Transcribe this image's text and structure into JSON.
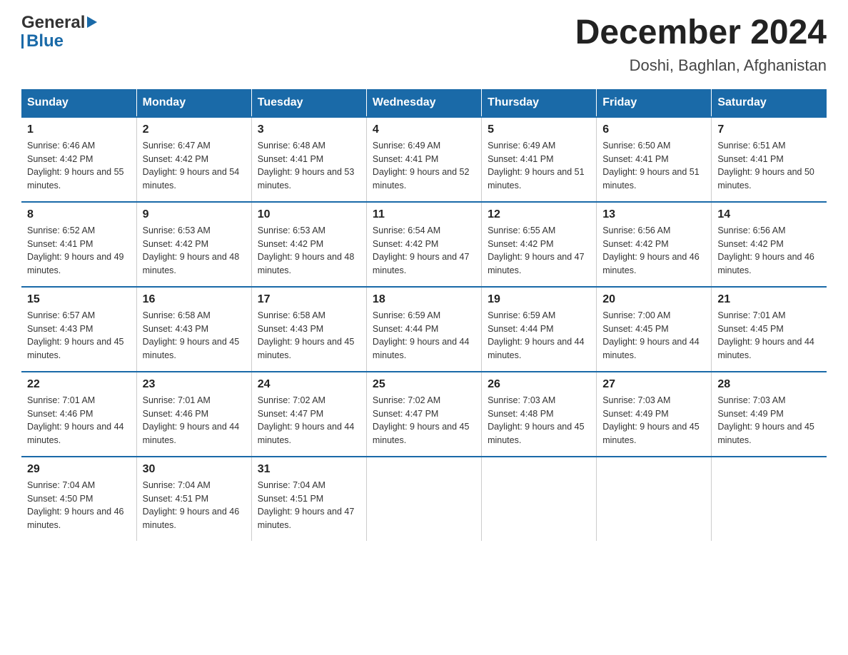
{
  "header": {
    "title": "December 2024",
    "subtitle": "Doshi, Baghlan, Afghanistan"
  },
  "days_header": [
    "Sunday",
    "Monday",
    "Tuesday",
    "Wednesday",
    "Thursday",
    "Friday",
    "Saturday"
  ],
  "weeks": [
    [
      {
        "day": "1",
        "sunrise": "6:46 AM",
        "sunset": "4:42 PM",
        "daylight": "9 hours and 55 minutes."
      },
      {
        "day": "2",
        "sunrise": "6:47 AM",
        "sunset": "4:42 PM",
        "daylight": "9 hours and 54 minutes."
      },
      {
        "day": "3",
        "sunrise": "6:48 AM",
        "sunset": "4:41 PM",
        "daylight": "9 hours and 53 minutes."
      },
      {
        "day": "4",
        "sunrise": "6:49 AM",
        "sunset": "4:41 PM",
        "daylight": "9 hours and 52 minutes."
      },
      {
        "day": "5",
        "sunrise": "6:49 AM",
        "sunset": "4:41 PM",
        "daylight": "9 hours and 51 minutes."
      },
      {
        "day": "6",
        "sunrise": "6:50 AM",
        "sunset": "4:41 PM",
        "daylight": "9 hours and 51 minutes."
      },
      {
        "day": "7",
        "sunrise": "6:51 AM",
        "sunset": "4:41 PM",
        "daylight": "9 hours and 50 minutes."
      }
    ],
    [
      {
        "day": "8",
        "sunrise": "6:52 AM",
        "sunset": "4:41 PM",
        "daylight": "9 hours and 49 minutes."
      },
      {
        "day": "9",
        "sunrise": "6:53 AM",
        "sunset": "4:42 PM",
        "daylight": "9 hours and 48 minutes."
      },
      {
        "day": "10",
        "sunrise": "6:53 AM",
        "sunset": "4:42 PM",
        "daylight": "9 hours and 48 minutes."
      },
      {
        "day": "11",
        "sunrise": "6:54 AM",
        "sunset": "4:42 PM",
        "daylight": "9 hours and 47 minutes."
      },
      {
        "day": "12",
        "sunrise": "6:55 AM",
        "sunset": "4:42 PM",
        "daylight": "9 hours and 47 minutes."
      },
      {
        "day": "13",
        "sunrise": "6:56 AM",
        "sunset": "4:42 PM",
        "daylight": "9 hours and 46 minutes."
      },
      {
        "day": "14",
        "sunrise": "6:56 AM",
        "sunset": "4:42 PM",
        "daylight": "9 hours and 46 minutes."
      }
    ],
    [
      {
        "day": "15",
        "sunrise": "6:57 AM",
        "sunset": "4:43 PM",
        "daylight": "9 hours and 45 minutes."
      },
      {
        "day": "16",
        "sunrise": "6:58 AM",
        "sunset": "4:43 PM",
        "daylight": "9 hours and 45 minutes."
      },
      {
        "day": "17",
        "sunrise": "6:58 AM",
        "sunset": "4:43 PM",
        "daylight": "9 hours and 45 minutes."
      },
      {
        "day": "18",
        "sunrise": "6:59 AM",
        "sunset": "4:44 PM",
        "daylight": "9 hours and 44 minutes."
      },
      {
        "day": "19",
        "sunrise": "6:59 AM",
        "sunset": "4:44 PM",
        "daylight": "9 hours and 44 minutes."
      },
      {
        "day": "20",
        "sunrise": "7:00 AM",
        "sunset": "4:45 PM",
        "daylight": "9 hours and 44 minutes."
      },
      {
        "day": "21",
        "sunrise": "7:01 AM",
        "sunset": "4:45 PM",
        "daylight": "9 hours and 44 minutes."
      }
    ],
    [
      {
        "day": "22",
        "sunrise": "7:01 AM",
        "sunset": "4:46 PM",
        "daylight": "9 hours and 44 minutes."
      },
      {
        "day": "23",
        "sunrise": "7:01 AM",
        "sunset": "4:46 PM",
        "daylight": "9 hours and 44 minutes."
      },
      {
        "day": "24",
        "sunrise": "7:02 AM",
        "sunset": "4:47 PM",
        "daylight": "9 hours and 44 minutes."
      },
      {
        "day": "25",
        "sunrise": "7:02 AM",
        "sunset": "4:47 PM",
        "daylight": "9 hours and 45 minutes."
      },
      {
        "day": "26",
        "sunrise": "7:03 AM",
        "sunset": "4:48 PM",
        "daylight": "9 hours and 45 minutes."
      },
      {
        "day": "27",
        "sunrise": "7:03 AM",
        "sunset": "4:49 PM",
        "daylight": "9 hours and 45 minutes."
      },
      {
        "day": "28",
        "sunrise": "7:03 AM",
        "sunset": "4:49 PM",
        "daylight": "9 hours and 45 minutes."
      }
    ],
    [
      {
        "day": "29",
        "sunrise": "7:04 AM",
        "sunset": "4:50 PM",
        "daylight": "9 hours and 46 minutes."
      },
      {
        "day": "30",
        "sunrise": "7:04 AM",
        "sunset": "4:51 PM",
        "daylight": "9 hours and 46 minutes."
      },
      {
        "day": "31",
        "sunrise": "7:04 AM",
        "sunset": "4:51 PM",
        "daylight": "9 hours and 47 minutes."
      },
      null,
      null,
      null,
      null
    ]
  ],
  "labels": {
    "sunrise_prefix": "Sunrise: ",
    "sunset_prefix": "Sunset: ",
    "daylight_prefix": "Daylight: "
  },
  "logo": {
    "general": "General",
    "blue": "Blue"
  },
  "colors": {
    "header_bg": "#1a6aa8",
    "header_text": "#ffffff",
    "border_top": "#1a6aa8"
  }
}
